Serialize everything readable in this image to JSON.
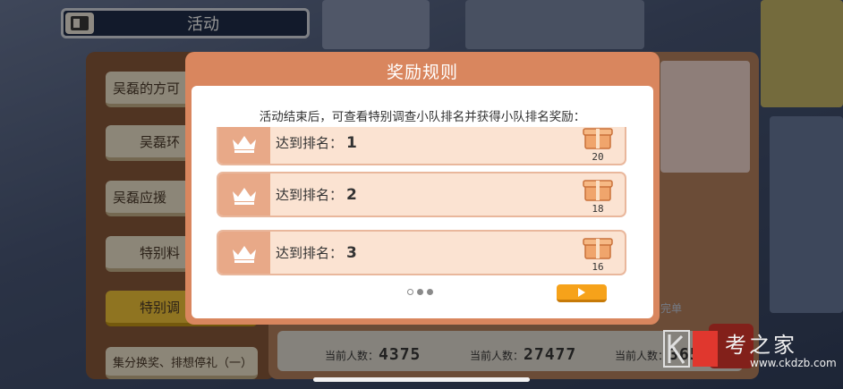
{
  "header": {
    "title": "活动"
  },
  "sidebar": {
    "items": [
      {
        "label": "吴磊的方可"
      },
      {
        "label": "吴磊环"
      },
      {
        "label": "吴磊应援"
      },
      {
        "label": "特别料"
      },
      {
        "label": "特别调"
      },
      {
        "label": "集分换奖、排想停礼（一）"
      }
    ]
  },
  "counts": [
    {
      "label": "当前人数：",
      "value": "4375"
    },
    {
      "label": "当前人数：",
      "value": "27477"
    },
    {
      "label": "当前人数：",
      "value": "3655"
    }
  ],
  "side_label": "完单",
  "modal": {
    "title": "奖励规则",
    "description": "活动结束后，可查看特别调查小队排名并获得小队排名奖励：",
    "rank_label": "达到排名：",
    "rows": [
      {
        "rank": "1",
        "qty": "20"
      },
      {
        "rank": "2",
        "qty": "18"
      },
      {
        "rank": "3",
        "qty": "16"
      }
    ],
    "pagination": {
      "current": 1,
      "total": 3
    }
  },
  "watermark": {
    "text": "考之家",
    "url": "www.ckdzb.com"
  },
  "colors": {
    "modal_header": "#d9865e",
    "row_bg": "#fbe3d2",
    "crown_cell": "#e8a988",
    "next_button": "#f6a21a",
    "active_tab": "#f7c83a"
  }
}
